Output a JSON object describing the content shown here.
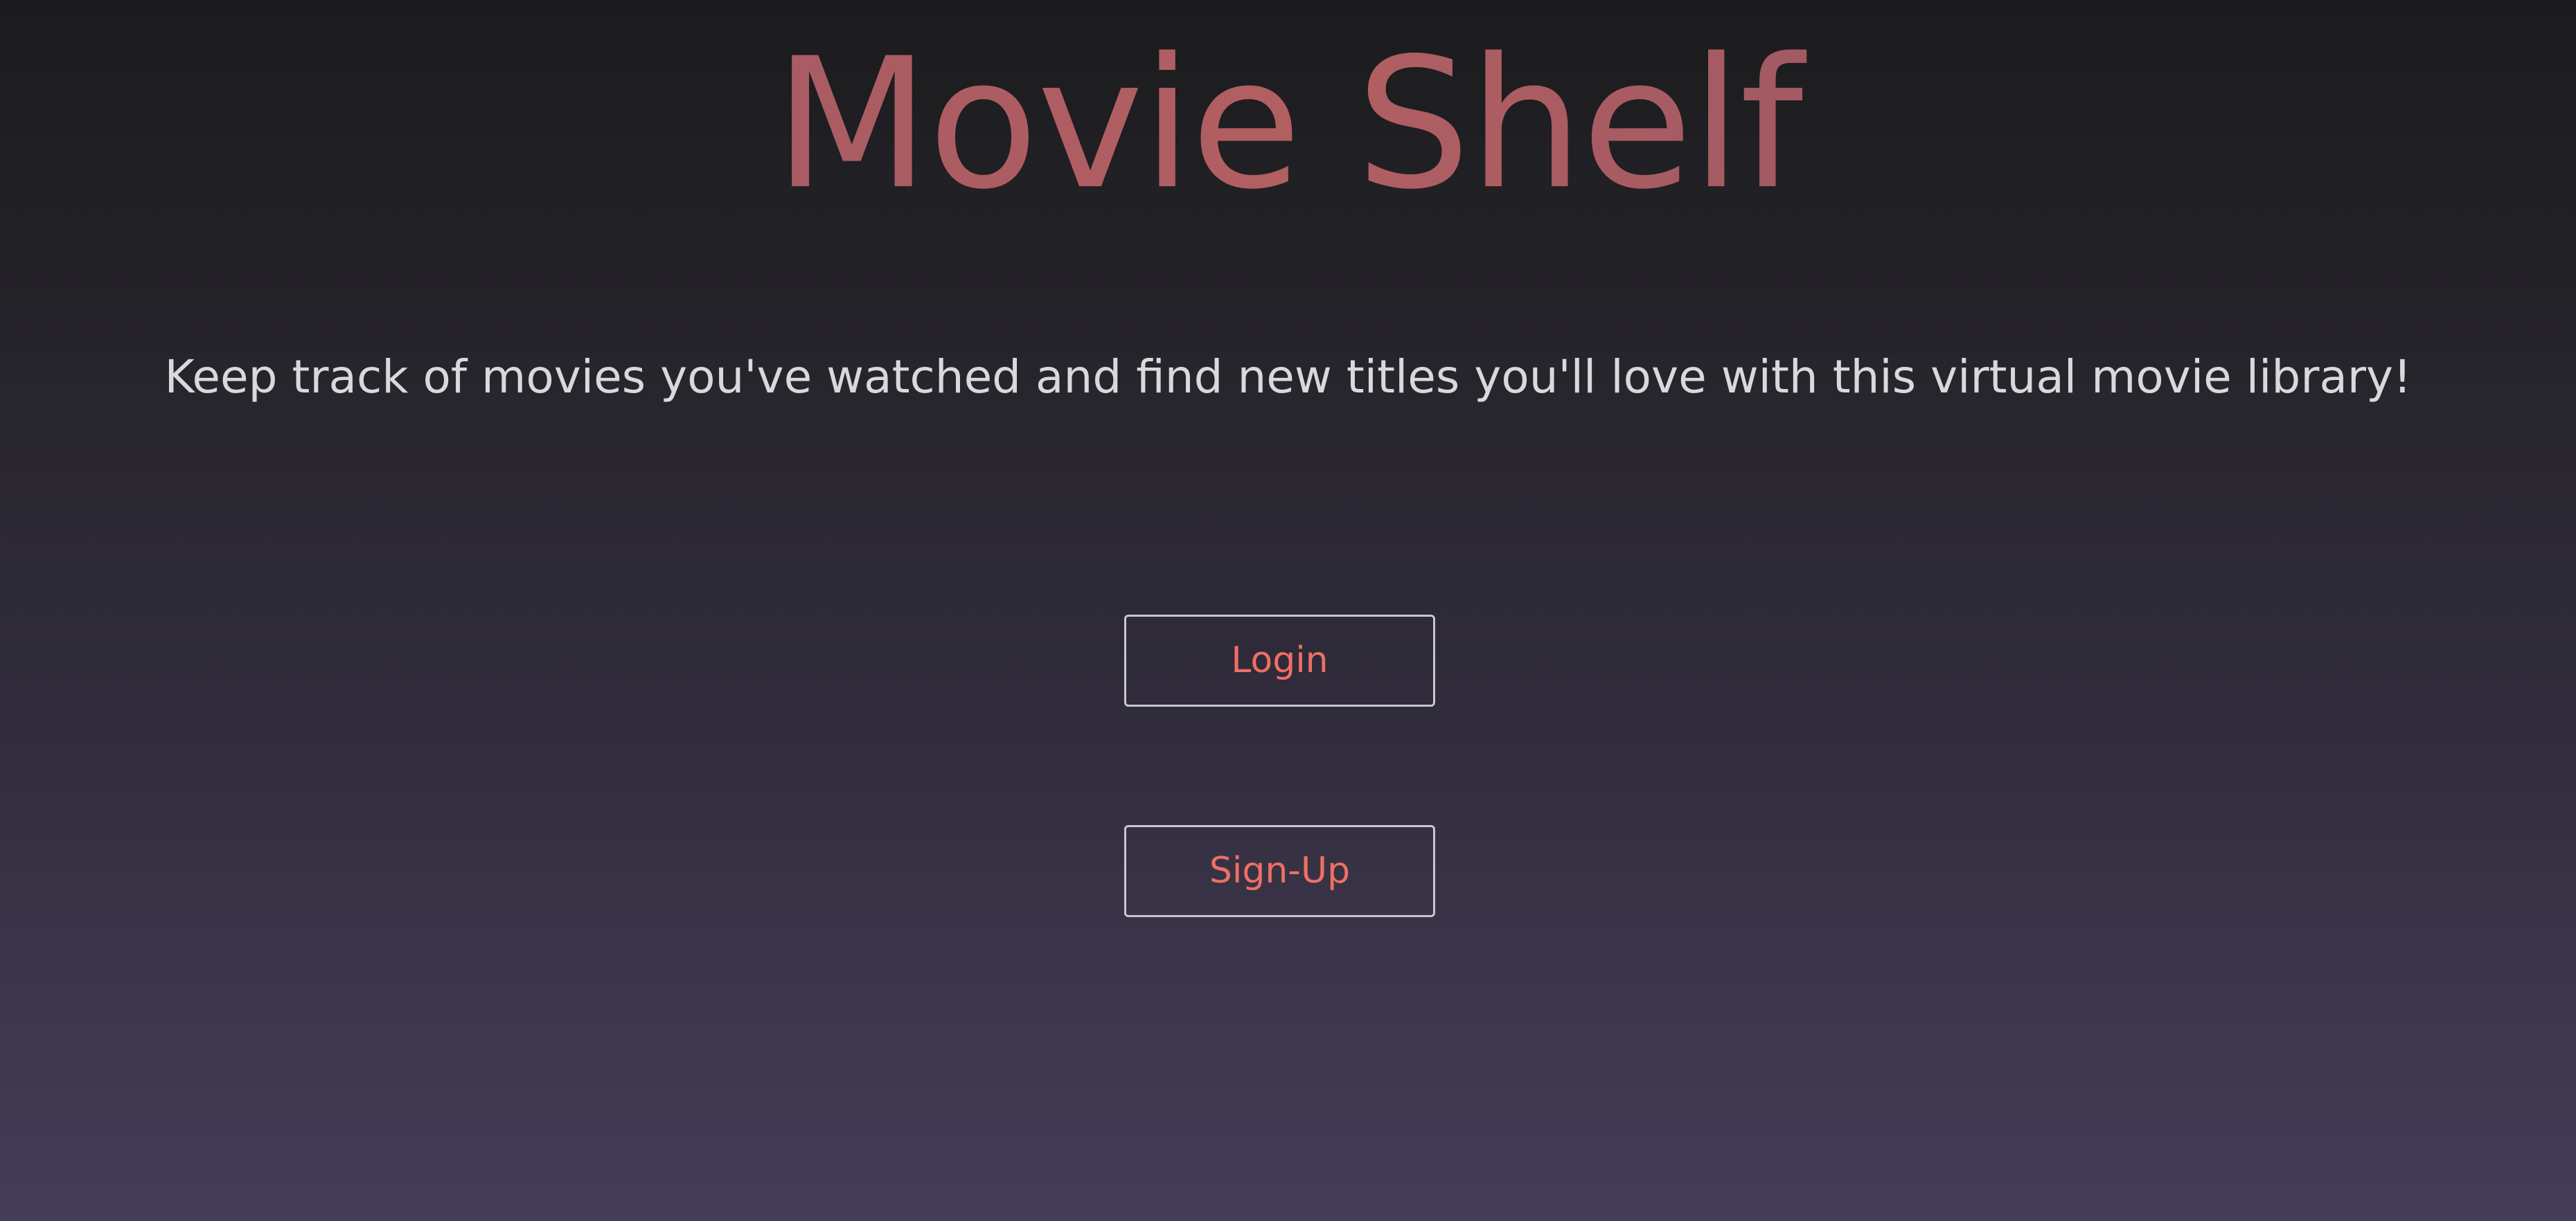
{
  "header": {
    "title": "Movie Shelf"
  },
  "main": {
    "tagline": "Keep track of movies you've watched and find new titles you'll love with this virtual movie library!",
    "login_label": "Login",
    "signup_label": "Sign-Up"
  },
  "colors": {
    "title_gradient": [
      "#9a5664",
      "#b25f62",
      "#8a5364"
    ],
    "button_text": "#ee6f64",
    "button_border": "#c9c6cf",
    "tagline_text": "#d9d9dc",
    "background_top": "#1b1b1d",
    "background_bottom": "#463d57"
  }
}
